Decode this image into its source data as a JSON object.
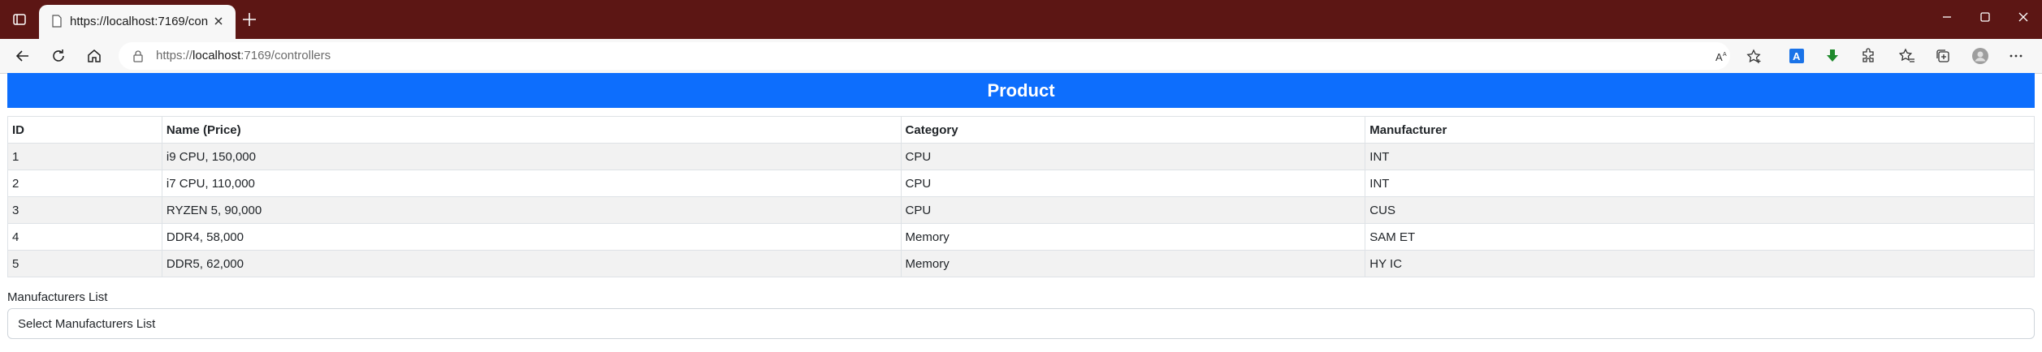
{
  "browser": {
    "tab_title": "https://localhost:7169/controllers",
    "url_scheme": "https://",
    "url_host": "localhost",
    "url_rest": ":7169/controllers"
  },
  "page": {
    "banner_title": "Product",
    "table": {
      "headers": [
        "ID",
        "Name (Price)",
        "Category",
        "Manufacturer"
      ],
      "rows": [
        [
          "1",
          "i9 CPU, 150,000",
          "CPU",
          "INT"
        ],
        [
          "2",
          "i7 CPU, 110,000",
          "CPU",
          "INT"
        ],
        [
          "3",
          "RYZEN 5, 90,000",
          "CPU",
          "CUS"
        ],
        [
          "4",
          "DDR4, 58,000",
          "Memory",
          "SAM ET"
        ],
        [
          "5",
          "DDR5, 62,000",
          "Memory",
          "HY IC"
        ]
      ]
    },
    "manufacturers_label": "Manufacturers List",
    "manufacturers_select": "Select Manufacturers List"
  },
  "colors": {
    "titlebar": "#5c1614",
    "banner": "#0d6efd"
  }
}
